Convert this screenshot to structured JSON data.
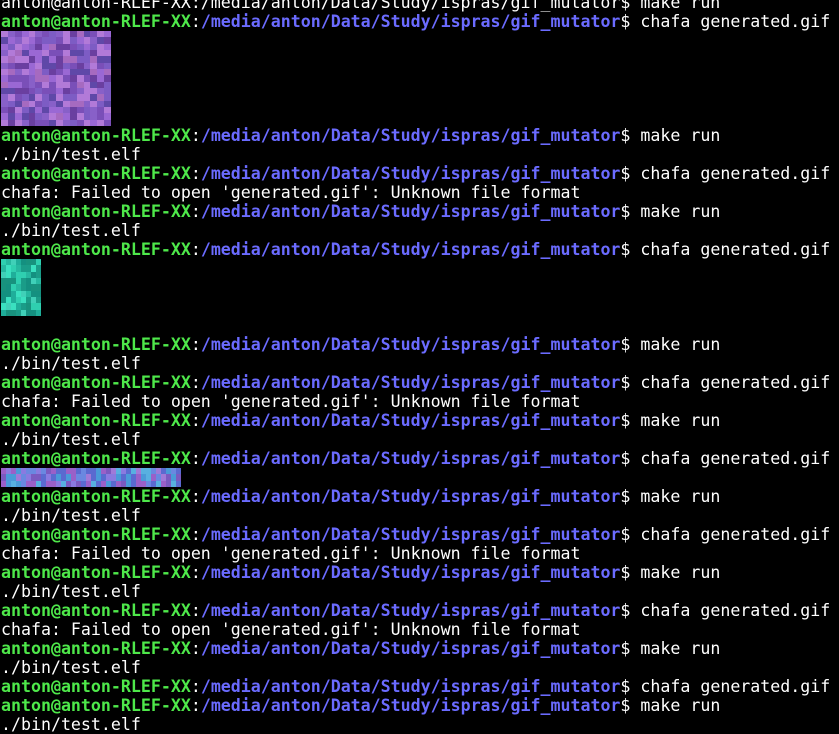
{
  "terminal": {
    "prompt_user": "anton@anton-RLEF-XX",
    "prompt_sep": ":",
    "prompt_path": "/media/anton/Data/Study/ispras/gif_mutator",
    "prompt_dollar": "$ ",
    "colors": {
      "background": "#000000",
      "user": "#4ee84a",
      "path": "#6b6bff",
      "text": "#ffffff"
    },
    "entries": [
      {
        "type": "partial",
        "text": "anton@anton-RLEF-XX:/media/anton/Data/Study/ispras/gif_mutator$ make run"
      },
      {
        "type": "prompt",
        "cmd": "chafa generated.gif"
      },
      {
        "type": "image",
        "rows": 5,
        "cols": 8,
        "width_cells": 11,
        "palette": [
          "#7a4fb8",
          "#9a68d4",
          "#6a3fa0",
          "#b27ad8",
          "#8860c8",
          "#5f48a8",
          "#a66ac0",
          "#7d5cc4"
        ]
      },
      {
        "type": "prompt",
        "cmd": "make run"
      },
      {
        "type": "output",
        "text": "./bin/test.elf"
      },
      {
        "type": "prompt",
        "cmd": "chafa generated.gif"
      },
      {
        "type": "output",
        "text": "chafa: Failed to open 'generated.gif': Unknown file format"
      },
      {
        "type": "prompt",
        "cmd": "make run"
      },
      {
        "type": "output",
        "text": "./bin/test.elf"
      },
      {
        "type": "prompt",
        "cmd": "chafa generated.gif"
      },
      {
        "type": "image",
        "rows": 3,
        "cols": 4,
        "width_cells": 4,
        "palette": [
          "#1fae9a",
          "#2fcfb0",
          "#18927e",
          "#3ae0c0",
          "#149080",
          "#26b8a0",
          "#40d0b8",
          "#1a9c88"
        ]
      },
      {
        "type": "blank"
      },
      {
        "type": "prompt",
        "cmd": "make run"
      },
      {
        "type": "output",
        "text": "./bin/test.elf"
      },
      {
        "type": "prompt",
        "cmd": "chafa generated.gif"
      },
      {
        "type": "output",
        "text": "chafa: Failed to open 'generated.gif': Unknown file format"
      },
      {
        "type": "prompt",
        "cmd": "make run"
      },
      {
        "type": "output",
        "text": "./bin/test.elf"
      },
      {
        "type": "prompt",
        "cmd": "chafa generated.gif"
      },
      {
        "type": "image",
        "rows": 1,
        "cols": 18,
        "width_cells": 18,
        "palette": [
          "#5a6ad0",
          "#8a7ae0",
          "#4a9ad8",
          "#9a60c8",
          "#6a88e0",
          "#7a5ac0",
          "#58b0e0",
          "#a07ad8"
        ]
      },
      {
        "type": "prompt",
        "cmd": "make run"
      },
      {
        "type": "output",
        "text": "./bin/test.elf"
      },
      {
        "type": "prompt",
        "cmd": "chafa generated.gif"
      },
      {
        "type": "output",
        "text": "chafa: Failed to open 'generated.gif': Unknown file format"
      },
      {
        "type": "prompt",
        "cmd": "make run"
      },
      {
        "type": "output",
        "text": "./bin/test.elf"
      },
      {
        "type": "prompt",
        "cmd": "chafa generated.gif"
      },
      {
        "type": "output",
        "text": "chafa: Failed to open 'generated.gif': Unknown file format"
      },
      {
        "type": "prompt",
        "cmd": "make run"
      },
      {
        "type": "output",
        "text": "./bin/test.elf"
      },
      {
        "type": "prompt",
        "cmd": "chafa generated.gif"
      },
      {
        "type": "prompt",
        "cmd": "make run"
      },
      {
        "type": "output",
        "text": "./bin/test.elf"
      }
    ]
  }
}
